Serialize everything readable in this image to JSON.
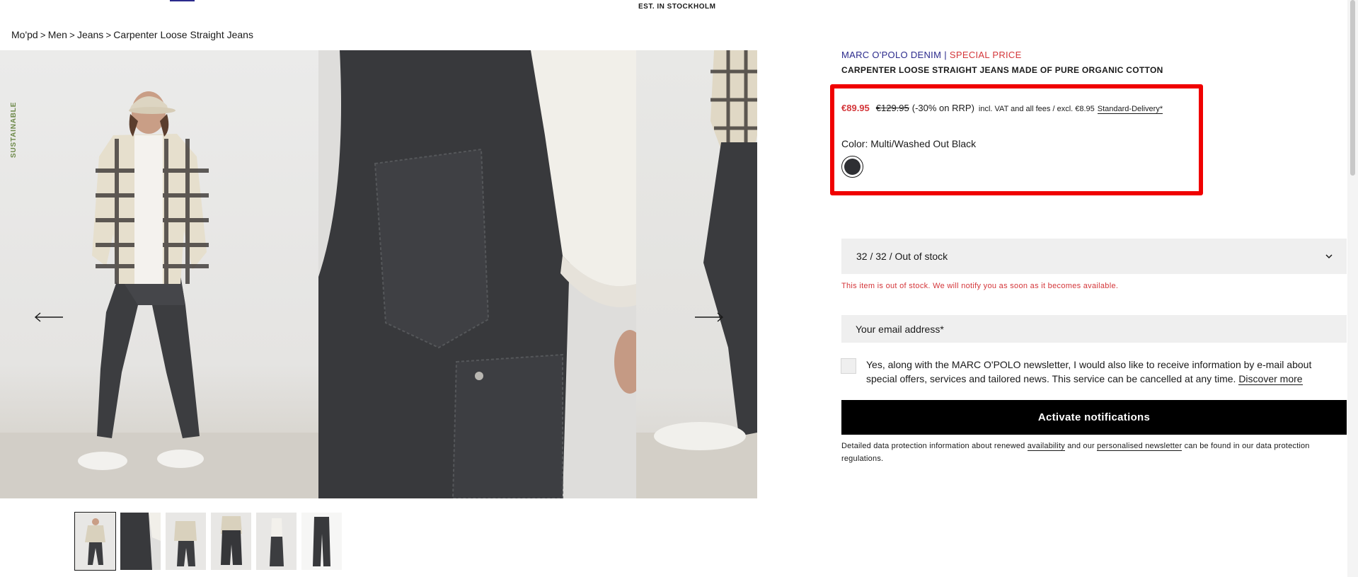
{
  "header": {
    "tagline": "EST. IN STOCKHOLM"
  },
  "breadcrumb": {
    "items": [
      "Mo'pd",
      "Men",
      "Jeans",
      "Carpenter Loose Straight Jeans"
    ],
    "separator": ">"
  },
  "gallery": {
    "badge": "SUSTAINABLE",
    "prev_icon": "arrow-left-icon",
    "next_icon": "arrow-right-icon",
    "thumbnail_count": 6,
    "active_thumbnail": 1
  },
  "product": {
    "brand": "MARC O'POLO DENIM",
    "brand_separator": "|",
    "special_label": "SPECIAL PRICE",
    "title": "CARPENTER LOOSE STRAIGHT JEANS MADE OF PURE ORGANIC COTTON",
    "price_current": "€89.95",
    "price_old": "€129.95",
    "discount": "(-30% on RRP)",
    "price_note": "incl. VAT and all fees / excl. €8.95",
    "delivery_link": "Standard-Delivery*",
    "color_label": "Color: Multi/Washed Out Black",
    "swatch_color": "#2e2f33"
  },
  "size_select": {
    "value": "32 / 32 / Out of stock",
    "icon": "chevron-down-icon"
  },
  "out_of_stock_message": "This item is out of stock. We will notify you as soon as it becomes available.",
  "email": {
    "placeholder": "Your email address*",
    "value": ""
  },
  "newsletter": {
    "text": "Yes, along with the MARC O'POLO newsletter, I would also like to receive information by e-mail about special offers, services and tailored news. This service can be cancelled at any time.",
    "link": "Discover more",
    "checked": false
  },
  "cta": {
    "label": "Activate notifications"
  },
  "privacy": {
    "part1": "Detailed data protection information about renewed",
    "link1": "availability",
    "part2": "and our",
    "link2": "personalised newsletter",
    "part3": "can be found in our data protection regulations."
  },
  "colors": {
    "brand": "#2b2a8c",
    "sale_red": "#d4363a",
    "highlight": "#f00000",
    "cta_bg": "#000000",
    "field_bg": "#efefef"
  }
}
